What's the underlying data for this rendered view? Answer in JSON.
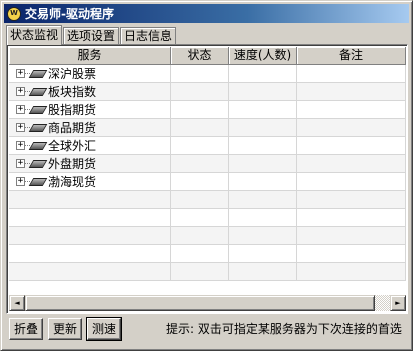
{
  "window": {
    "title": "交易师-驱动程序",
    "icon_text": "W"
  },
  "tabs": [
    {
      "label": "状态监视",
      "active": true
    },
    {
      "label": "选项设置",
      "active": false
    },
    {
      "label": "日志信息",
      "active": false
    }
  ],
  "table": {
    "columns": [
      "服务",
      "状态",
      "速度(人数)",
      "备注"
    ],
    "rows": [
      {
        "service": "深沪股票",
        "expander": "+",
        "status": "",
        "speed": "",
        "note": ""
      },
      {
        "service": "板块指数",
        "expander": "+",
        "status": "",
        "speed": "",
        "note": ""
      },
      {
        "service": "股指期货",
        "expander": "+",
        "status": "",
        "speed": "",
        "note": ""
      },
      {
        "service": "商品期货",
        "expander": "+",
        "status": "",
        "speed": "",
        "note": ""
      },
      {
        "service": "全球外汇",
        "expander": "+",
        "status": "",
        "speed": "",
        "note": ""
      },
      {
        "service": "外盘期货",
        "expander": "+",
        "status": "",
        "speed": "",
        "note": ""
      },
      {
        "service": "渤海现货",
        "expander": "+",
        "status": "",
        "speed": "",
        "note": ""
      }
    ]
  },
  "scrollbar": {
    "left_arrow": "◄",
    "right_arrow": "►"
  },
  "buttons": {
    "collapse": "折叠",
    "refresh": "更新",
    "speed_test": "测速"
  },
  "hint": "提示: 双击可指定某服务器为下次连接的首选"
}
